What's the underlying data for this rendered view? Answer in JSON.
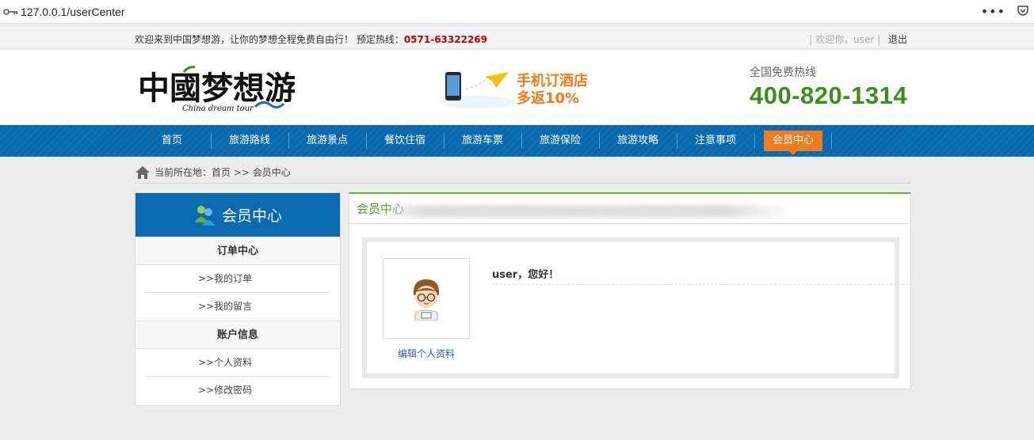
{
  "browser": {
    "url": "127.0.0.1/userCenter",
    "menu_dots": "•••"
  },
  "topbar": {
    "welcome": "欢迎来到中国梦想游，让你的梦想全程免费自由行！ 预定热线：",
    "hotline": "0571-63322269",
    "user_greeting": "| 欢迎你，user |",
    "logout": "退出"
  },
  "header": {
    "logo_cn": "中國梦想游",
    "logo_en": "China dream tour",
    "promo_line1": "手机订酒店",
    "promo_line2": "多返10%",
    "hotline_label": "全国免费热线",
    "hotline_number": "400-820-1314"
  },
  "nav": {
    "items": [
      {
        "label": "首页"
      },
      {
        "label": "旅游路线"
      },
      {
        "label": "旅游景点"
      },
      {
        "label": "餐饮住宿"
      },
      {
        "label": "旅游车票"
      },
      {
        "label": "旅游保险"
      },
      {
        "label": "旅游攻略"
      },
      {
        "label": "注意事项"
      },
      {
        "label": "会员中心"
      }
    ],
    "active_index": 8
  },
  "breadcrumb": {
    "text": "当前所在地：首页 >> 会员中心"
  },
  "sidebar": {
    "title": "会员中心",
    "groups": [
      {
        "label": "订单中心",
        "links": [
          {
            "label": ">>我的订单"
          },
          {
            "label": ">>我的留言"
          }
        ]
      },
      {
        "label": "账户信息",
        "links": [
          {
            "label": ">>个人资料"
          },
          {
            "label": ">>修改密码"
          }
        ]
      }
    ]
  },
  "main": {
    "title": "会员中心",
    "greeting": "user，您好！",
    "edit_profile": "编辑个人资料"
  },
  "colors": {
    "nav_blue": "#0c6fb5",
    "active_orange": "#f07c1d",
    "hotline_green": "#3a8f19",
    "hotline_red": "#c00000",
    "title_green": "#4f9e25"
  }
}
